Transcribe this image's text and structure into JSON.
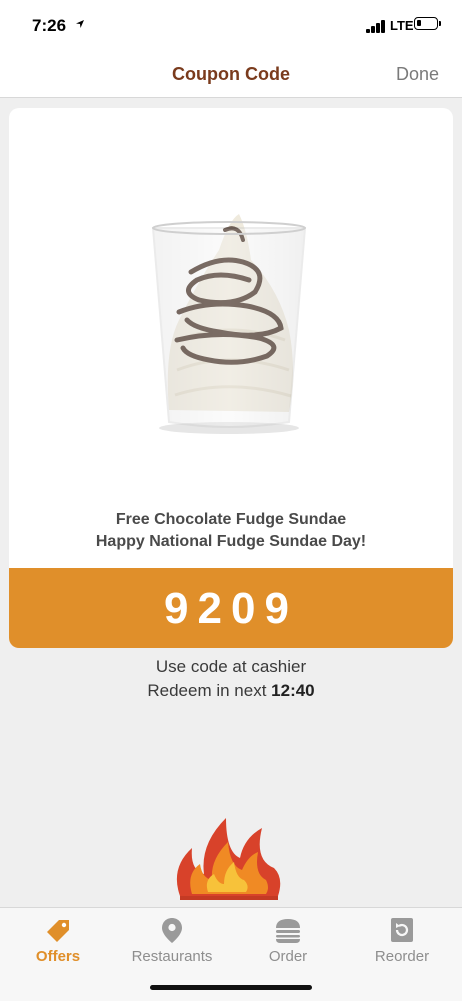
{
  "status": {
    "time": "7:26",
    "network": "LTE"
  },
  "nav": {
    "title": "Coupon Code",
    "done_label": "Done"
  },
  "coupon": {
    "title": "Free Chocolate Fudge Sundae",
    "subtitle": "Happy National Fudge Sundae Day!",
    "code": "9209",
    "instruction": "Use code at cashier",
    "redeem_prefix": "Redeem in next ",
    "redeem_time": "12:40"
  },
  "tabs": [
    {
      "label": "Offers",
      "icon": "tag-icon",
      "active": true
    },
    {
      "label": "Restaurants",
      "icon": "location-pin-icon",
      "active": false
    },
    {
      "label": "Order",
      "icon": "burger-icon",
      "active": false
    },
    {
      "label": "Reorder",
      "icon": "reorder-icon",
      "active": false
    }
  ],
  "colors": {
    "accent": "#e08f2a",
    "title_brown": "#7a3b1d",
    "background": "#efefef"
  }
}
